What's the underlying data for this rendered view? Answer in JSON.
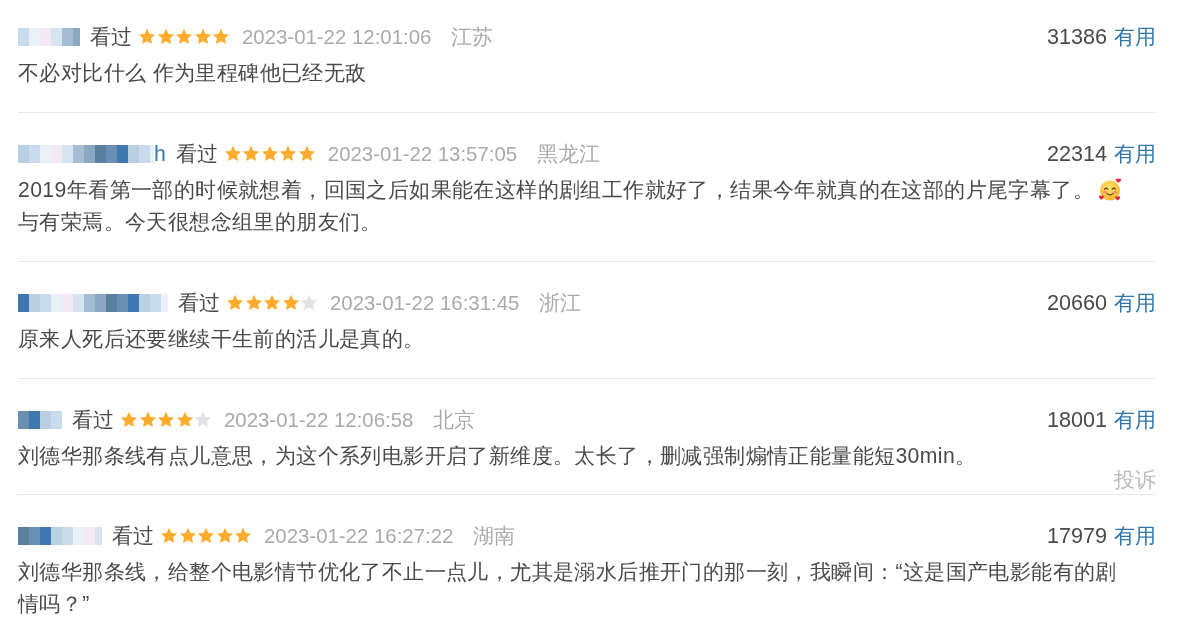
{
  "reviews": [
    {
      "username": {
        "redacted": true
      },
      "status": "看过",
      "stars": 5,
      "time": "2023-01-22 12:01:06",
      "location": "江苏",
      "votes": "31386",
      "vote_label": "有用",
      "comment": [
        {
          "kind": "text",
          "text": "不必对比什么 作为里程碑他已经无敌"
        }
      ]
    },
    {
      "username": {
        "redacted": true,
        "visible_tail": "h"
      },
      "status": "看过",
      "stars": 5,
      "time": "2023-01-22 13:57:05",
      "location": "黑龙江",
      "votes": "22314",
      "vote_label": "有用",
      "comment": [
        {
          "kind": "text",
          "text": "2019年看第一部的时候就想着，回国之后如果能在这样的剧组工作就好了，结果今年就真的在这部的片尾字幕了。"
        },
        {
          "kind": "emoji"
        },
        {
          "kind": "text",
          "text": "与有荣焉。今天很想念组里的朋友们。"
        }
      ]
    },
    {
      "username": {
        "redacted": true
      },
      "status": "看过",
      "stars": 4,
      "time": "2023-01-22 16:31:45",
      "location": "浙江",
      "votes": "20660",
      "vote_label": "有用",
      "comment": [
        {
          "kind": "text",
          "text": "原来人死后还要继续干生前的活儿是真的。"
        }
      ]
    },
    {
      "username": {
        "redacted": true
      },
      "status": "看过",
      "stars": 4,
      "time": "2023-01-22 12:06:58",
      "location": "北京",
      "votes": "18001",
      "vote_label": "有用",
      "comment": [
        {
          "kind": "text",
          "text": "刘德华那条线有点儿意思，为这个系列电影开启了新维度。太长了，删减强制煽情正能量能短30min。"
        }
      ],
      "report": "投诉"
    },
    {
      "username": {
        "redacted": true
      },
      "status": "看过",
      "stars": 5,
      "time": "2023-01-22 16:27:22",
      "location": "湖南",
      "votes": "17979",
      "vote_label": "有用",
      "comment": [
        {
          "kind": "text",
          "text": "刘德华那条线，给整个电影情节优化了不止一点儿，尤其是溺水后推开门的那一刻，我瞬间：“这是国产电影能有的剧情吗？”"
        }
      ]
    }
  ]
}
